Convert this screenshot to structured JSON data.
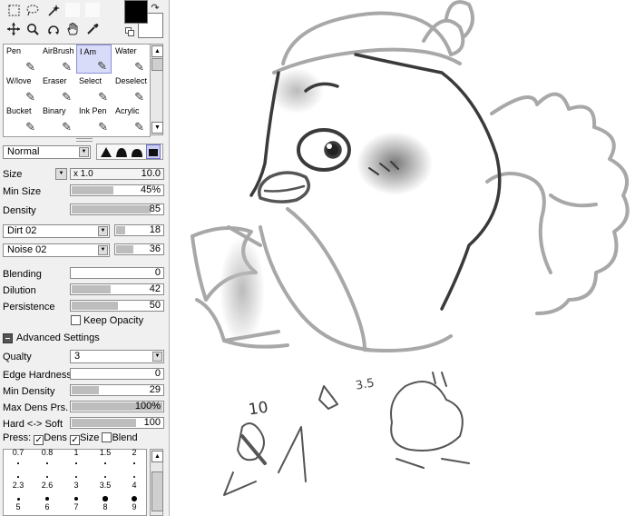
{
  "tools": {
    "selection": [
      "rect-select-icon",
      "lasso-icon",
      "magic-wand-icon",
      "blank",
      "blank"
    ],
    "view": [
      "move-icon",
      "zoom-icon",
      "rotate-icon",
      "hand-icon",
      "eyedropper-icon"
    ]
  },
  "brushes": [
    {
      "label": "Pen",
      "icon": "pen-icon",
      "selected": false
    },
    {
      "label": "AirBrush",
      "icon": "airbrush-icon",
      "selected": false
    },
    {
      "label": "I Am",
      "icon": "brush-icon",
      "selected": true
    },
    {
      "label": "Water",
      "icon": "water-brush-icon",
      "selected": false
    },
    {
      "label": "W/love",
      "icon": "pencil-icon",
      "selected": false
    },
    {
      "label": "Eraser",
      "icon": "eraser-icon",
      "selected": false
    },
    {
      "label": "Select",
      "icon": "select-pen-icon",
      "selected": false
    },
    {
      "label": "Deselect",
      "icon": "deselect-icon",
      "selected": false
    },
    {
      "label": "Bucket",
      "icon": "bucket-icon",
      "selected": false
    },
    {
      "label": "Binary",
      "icon": "binary-pen-icon",
      "selected": false
    },
    {
      "label": "Ink Pen",
      "icon": "ink-pen-icon",
      "selected": false
    },
    {
      "label": "Acrylic",
      "icon": "acrylic-icon",
      "selected": false
    }
  ],
  "blend_mode": "Normal",
  "size": {
    "label": "Size",
    "multiplier": "x 1.0",
    "value": "10.0"
  },
  "min_size": {
    "label": "Min Size",
    "value": "45%",
    "fill": 0.45
  },
  "density": {
    "label": "Density",
    "value": "85",
    "fill": 0.85
  },
  "texture1": {
    "name": "Dirt 02",
    "value": "18",
    "fill": 0.18
  },
  "texture2": {
    "name": "Noise 02",
    "value": "36",
    "fill": 0.36
  },
  "blending": {
    "label": "Blending",
    "value": "0",
    "fill": 0
  },
  "dilution": {
    "label": "Dilution",
    "value": "42",
    "fill": 0.42
  },
  "persistence": {
    "label": "Persistence",
    "value": "50",
    "fill": 0.5
  },
  "keep_opacity": "Keep Opacity",
  "advanced": "Advanced Settings",
  "quality": {
    "label": "Qualty",
    "value": "3"
  },
  "edge_hardness": {
    "label": "Edge Hardness",
    "value": "0",
    "fill": 0
  },
  "min_density": {
    "label": "Min Density",
    "value": "29",
    "fill": 0.29
  },
  "max_dens": {
    "label": "Max Dens Prs.",
    "value": "100%",
    "fill": 1
  },
  "hard_soft": {
    "label": "Hard <-> Soft",
    "value": "100",
    "fill": 0.7
  },
  "press": {
    "label": "Press:",
    "dens": "Dens",
    "size": "Size",
    "blend": "Blend"
  },
  "sizes_row0": [
    "0.7",
    "0.8",
    "1",
    "1.5",
    "2"
  ],
  "sizes_row1": [
    "2.3",
    "2.6",
    "3",
    "3.5",
    "4"
  ],
  "sizes_row2": [
    "5",
    "6",
    "7",
    "8",
    "9"
  ],
  "sketch": {
    "note1": "10",
    "note2": "3.5"
  }
}
